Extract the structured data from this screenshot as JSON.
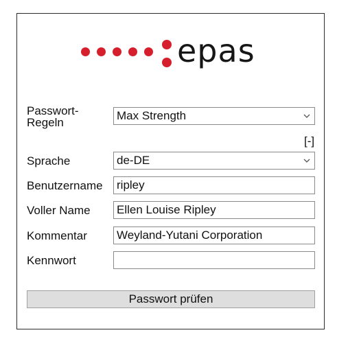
{
  "logo": {
    "text": "epas",
    "dot_color": "#d61f2c",
    "text_color": "#161616"
  },
  "form": {
    "password_rules": {
      "label": "Passwort-Regeln",
      "selected": "Max Strength",
      "collapse_toggle": "[-]"
    },
    "language": {
      "label": "Sprache",
      "selected": "de-DE"
    },
    "username": {
      "label": "Benutzername",
      "value": "ripley"
    },
    "full_name": {
      "label": "Voller Name",
      "value": "Ellen Louise Ripley"
    },
    "comment": {
      "label": "Kommentar",
      "value": "Weyland-Yutani Corporation"
    },
    "password": {
      "label": "Kennwort",
      "value": ""
    },
    "check_button": {
      "label": "Passwort prüfen"
    }
  },
  "icons": {
    "dropdown": "chevron-down-icon"
  }
}
